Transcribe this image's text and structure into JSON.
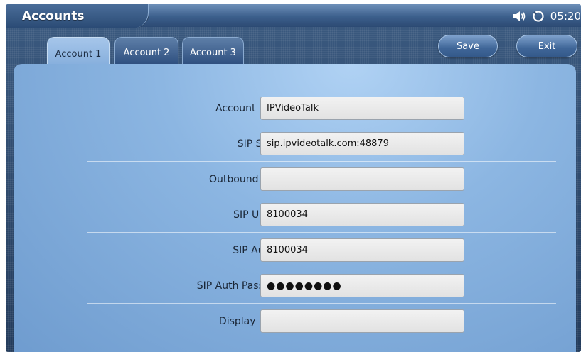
{
  "window": {
    "title": "Accounts",
    "time": "05:20",
    "icons": [
      "speaker-icon",
      "network-icon"
    ]
  },
  "tabs": [
    {
      "label": "Account 1",
      "active": true
    },
    {
      "label": "Account 2",
      "active": false
    },
    {
      "label": "Account 3",
      "active": false
    }
  ],
  "actions": {
    "save_label": "Save",
    "exit_label": "Exit"
  },
  "form": {
    "fields": [
      {
        "label": "Account Name:",
        "value": "IPVideoTalk"
      },
      {
        "label": "SIP Server:",
        "value": "sip.ipvideotalk.com:48879"
      },
      {
        "label": "Outbound Proxy:",
        "value": ""
      },
      {
        "label": "SIP User ID:",
        "value": "8100034"
      },
      {
        "label": "SIP Auth ID:",
        "value": "8100034"
      },
      {
        "label": "SIP Auth Password:",
        "value": "●●●●●●●●"
      },
      {
        "label": "Display Name:",
        "value": ""
      }
    ]
  }
}
